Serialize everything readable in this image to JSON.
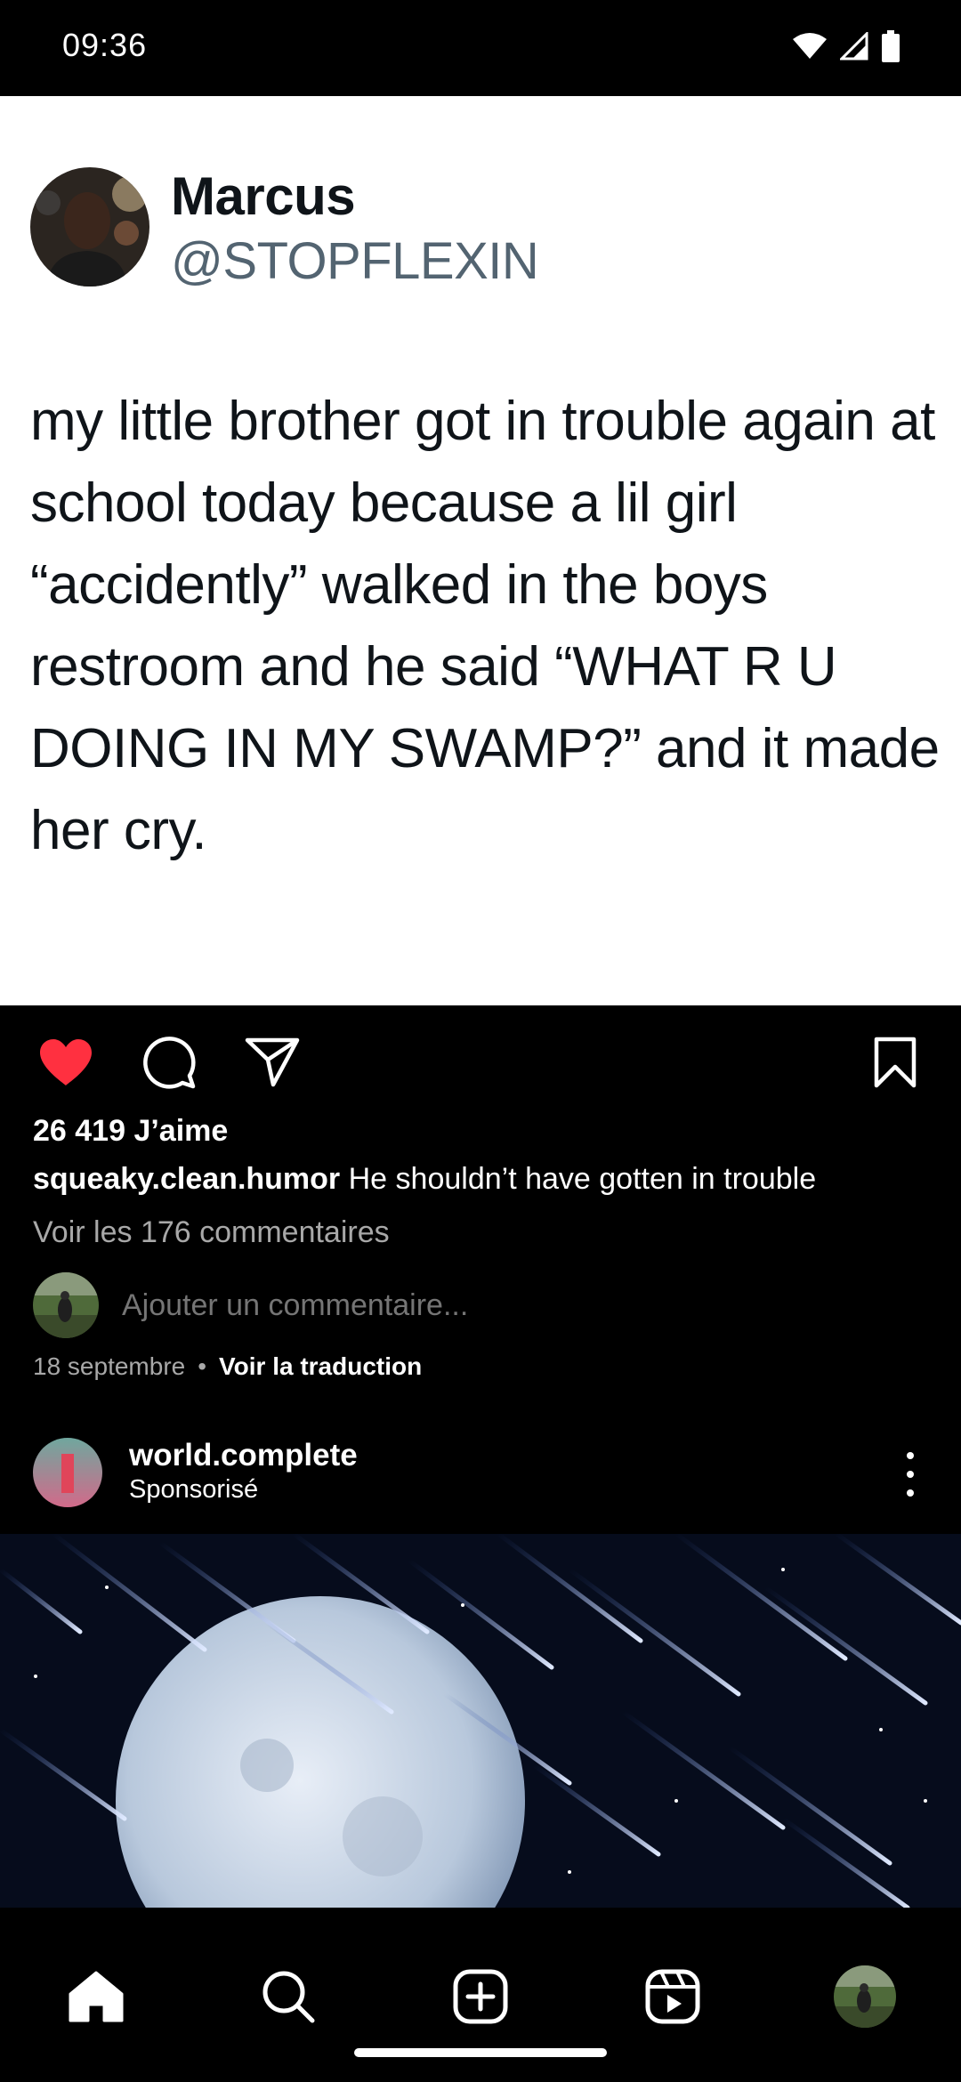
{
  "status_bar": {
    "time": "09:36",
    "icons": [
      "wifi-icon",
      "signal-icon",
      "battery-icon"
    ]
  },
  "tweet": {
    "name": "Marcus",
    "handle": "@STOPFLEXIN",
    "text": "my little brother got in trouble again at school today because a lil girl “accidently” walked in the boys restroom and he said “WHAT R U DOING IN MY SWAMP?” and it made her cry."
  },
  "post": {
    "liked": true,
    "like_color": "#ff3040",
    "likes_label": "26 419 J’aime",
    "caption_user": "squeaky.clean.humor",
    "caption_text": "He shouldn’t have gotten in trouble",
    "view_comments": "Voir les 176 commentaires",
    "comment_placeholder": "Ajouter un commentaire...",
    "date": "18 septembre",
    "translate": "Voir la traduction"
  },
  "post2": {
    "username": "world.complete",
    "sponsored": "Sponsorisé"
  },
  "bottom_nav": {
    "items": [
      "home-icon",
      "search-icon",
      "create-icon",
      "reels-icon",
      "profile-avatar"
    ]
  }
}
